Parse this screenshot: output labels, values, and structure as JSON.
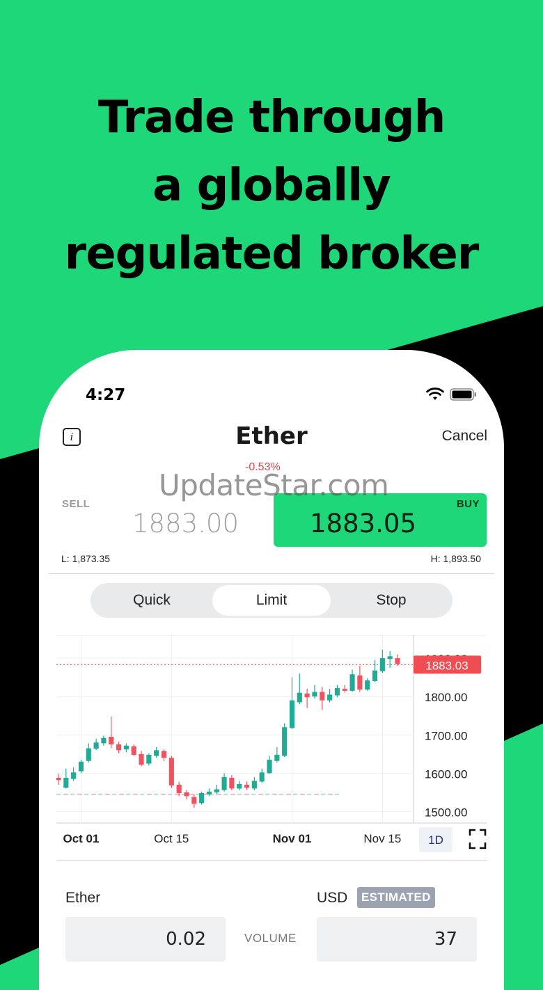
{
  "headline": [
    "Trade through",
    "a globally",
    "regulated broker"
  ],
  "watermark": "UpdateStar.com",
  "status": {
    "time": "4:27"
  },
  "header": {
    "title": "Ether",
    "cancel_label": "Cancel"
  },
  "quote": {
    "change": "-0.53%",
    "sell_label": "SELL",
    "sell_price": "1883.00",
    "buy_label": "BUY",
    "buy_price": "1883.05",
    "low": "L: 1,873.35",
    "high": "H: 1,893.50"
  },
  "order_types": {
    "items": [
      "Quick",
      "Limit",
      "Stop"
    ],
    "selected": "Limit"
  },
  "chart_data": {
    "type": "candlestick",
    "y_ticks": [
      "1500.00",
      "1600.00",
      "1700.00",
      "1800.00",
      "1900.00"
    ],
    "ylim": [
      1470,
      1960
    ],
    "x_ticks": [
      {
        "label": "Oct 01",
        "bold": true,
        "index": 3
      },
      {
        "label": "Oct 15",
        "bold": false,
        "index": 15
      },
      {
        "label": "Nov 01",
        "bold": true,
        "index": 31
      },
      {
        "label": "Nov 15",
        "bold": false,
        "index": 43
      }
    ],
    "current_price": "1883.03",
    "current_value": 1883.03,
    "reference_level": 1545,
    "timeframe": "1D",
    "up_color": "#22ab94",
    "down_color": "#f2525f",
    "candles": [
      [
        1588,
        1582,
        1598,
        1570
      ],
      [
        1562,
        1588,
        1612,
        1560
      ],
      [
        1585,
        1602,
        1615,
        1580
      ],
      [
        1605,
        1630,
        1635,
        1600
      ],
      [
        1632,
        1665,
        1678,
        1628
      ],
      [
        1664,
        1680,
        1690,
        1660
      ],
      [
        1678,
        1692,
        1698,
        1672
      ],
      [
        1695,
        1675,
        1748,
        1665
      ],
      [
        1675,
        1660,
        1682,
        1652
      ],
      [
        1662,
        1672,
        1678,
        1655
      ],
      [
        1670,
        1648,
        1675,
        1645
      ],
      [
        1650,
        1622,
        1658,
        1618
      ],
      [
        1625,
        1648,
        1652,
        1620
      ],
      [
        1645,
        1660,
        1668,
        1640
      ],
      [
        1658,
        1640,
        1662,
        1632
      ],
      [
        1640,
        1568,
        1645,
        1562
      ],
      [
        1570,
        1548,
        1578,
        1540
      ],
      [
        1550,
        1540,
        1556,
        1532
      ],
      [
        1538,
        1520,
        1545,
        1510
      ],
      [
        1522,
        1548,
        1552,
        1518
      ],
      [
        1545,
        1552,
        1560,
        1540
      ],
      [
        1550,
        1558,
        1570,
        1545
      ],
      [
        1556,
        1590,
        1600,
        1552
      ],
      [
        1588,
        1560,
        1595,
        1555
      ],
      [
        1560,
        1572,
        1580,
        1555
      ],
      [
        1570,
        1562,
        1578,
        1556
      ],
      [
        1560,
        1580,
        1590,
        1555
      ],
      [
        1578,
        1602,
        1612,
        1575
      ],
      [
        1600,
        1635,
        1645,
        1598
      ],
      [
        1632,
        1648,
        1668,
        1628
      ],
      [
        1645,
        1720,
        1730,
        1642
      ],
      [
        1718,
        1790,
        1850,
        1715
      ],
      [
        1785,
        1810,
        1860,
        1780
      ],
      [
        1808,
        1798,
        1820,
        1770
      ],
      [
        1800,
        1812,
        1830,
        1795
      ],
      [
        1812,
        1790,
        1825,
        1765
      ],
      [
        1790,
        1805,
        1820,
        1785
      ],
      [
        1803,
        1822,
        1830,
        1798
      ],
      [
        1820,
        1815,
        1830,
        1810
      ],
      [
        1815,
        1858,
        1870,
        1812
      ],
      [
        1855,
        1818,
        1880,
        1812
      ],
      [
        1818,
        1842,
        1848,
        1815
      ],
      [
        1840,
        1868,
        1895,
        1838
      ],
      [
        1866,
        1900,
        1922,
        1862
      ],
      [
        1898,
        1905,
        1918,
        1875
      ],
      [
        1900,
        1885,
        1910,
        1880
      ]
    ]
  },
  "order": {
    "asset_label": "Ether",
    "asset_value": "0.02",
    "volume_label": "VOLUME",
    "currency_label": "USD",
    "estimated_label": "ESTIMATED",
    "currency_value": "37"
  }
}
